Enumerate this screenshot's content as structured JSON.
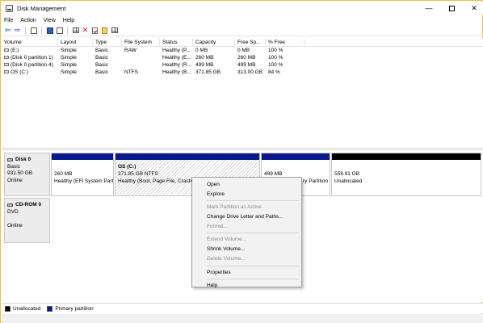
{
  "window": {
    "title": "Disk Management",
    "controls": {
      "minimize": "—",
      "maximize": "",
      "close": "✕"
    }
  },
  "menu": [
    "File",
    "Action",
    "View",
    "Help"
  ],
  "toolbar": {
    "icons": [
      "back-arrow",
      "forward-arrow",
      "console-tree",
      "help-book",
      "properties",
      "grid",
      "delete-x",
      "check",
      "open-doc",
      "view-grid"
    ]
  },
  "volume_list": {
    "columns": [
      "Volume",
      "Layout",
      "Type",
      "File System",
      "Status",
      "Capacity",
      "Free Sp...",
      "% Free"
    ],
    "rows": [
      [
        "(E:)",
        "Simple",
        "Basic",
        "RAW",
        "Healthy (P...",
        "0 MB",
        "0 MB",
        "100 %"
      ],
      [
        "(Disk 0 partition 1)",
        "Simple",
        "Basic",
        "",
        "Healthy (E...",
        "260 MB",
        "260 MB",
        "100 %"
      ],
      [
        "(Disk 0 partition 4)",
        "Simple",
        "Basic",
        "",
        "Healthy (R...",
        "499 MB",
        "499 MB",
        "100 %"
      ],
      [
        "OS (C:)",
        "Simple",
        "Basic",
        "NTFS",
        "Healthy (B...",
        "371.85 GB",
        "313.00 GB",
        "84 %"
      ]
    ]
  },
  "disks": [
    {
      "name": "Disk 0",
      "type": "Basic",
      "size": "931.50 GB",
      "status": "Online",
      "partitions": [
        {
          "title": "",
          "size": "260 MB",
          "status": "Healthy (EFI System Part",
          "kind": "primary"
        },
        {
          "title": "OS  (C:)",
          "size": "371.85 GB NTFS",
          "status": "Healthy (Boot, Page File, Crash D",
          "kind": "primary"
        },
        {
          "title": "",
          "size": "499 MB",
          "status": "ry Partition",
          "kind": "primary"
        },
        {
          "title": "",
          "size": "558.91 GB",
          "status": "Unallocated",
          "kind": "unallocated"
        }
      ]
    },
    {
      "name": "CD-ROM 0",
      "type": "DVD",
      "size": "",
      "status": "Online",
      "partitions": []
    }
  ],
  "legend": [
    {
      "label": "Unallocated",
      "color": "#000000"
    },
    {
      "label": "Primary partition",
      "color": "#0a1a8a"
    }
  ],
  "context_menu": {
    "items": [
      {
        "label": "Open",
        "enabled": true
      },
      {
        "label": "Explore",
        "enabled": true
      },
      {
        "label": "Mark Partition as Active",
        "enabled": false
      },
      {
        "label": "Change Drive Letter and Paths...",
        "enabled": true
      },
      {
        "label": "Format...",
        "enabled": false
      },
      {
        "label": "Extend Volume...",
        "enabled": false
      },
      {
        "label": "Shrink Volume...",
        "enabled": true
      },
      {
        "label": "Delete Volume...",
        "enabled": false
      },
      {
        "label": "Properties",
        "enabled": true
      },
      {
        "label": "Help",
        "enabled": true
      }
    ]
  },
  "colors": {
    "primary_partition": "#0a1a8a",
    "unallocated": "#000000",
    "window_border": "#e8c14a"
  }
}
